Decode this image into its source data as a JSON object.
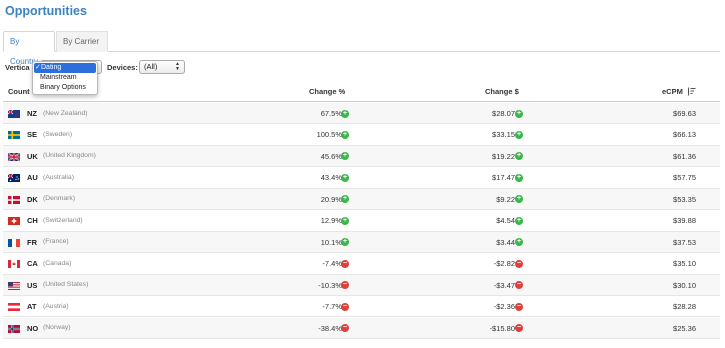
{
  "title": "Opportunities",
  "tabs": [
    {
      "label": "By Country",
      "active": true
    },
    {
      "label": "By Carrier",
      "active": false
    }
  ],
  "filters": {
    "verticals_label": "Vertica",
    "verticals_options": [
      "Dating",
      "Mainstream",
      "Binary Options"
    ],
    "verticals_selected": "Dating",
    "devices_label": "Devices:",
    "devices_value": "(All)"
  },
  "table": {
    "headers": {
      "country": "Count",
      "change_pct": "Change %",
      "change_usd": "Change $",
      "ecpm": "eCPM"
    },
    "rows": [
      {
        "code": "NZ",
        "name": "(New Zealand)",
        "change_pct": "67.5%",
        "change_usd": "$28.07",
        "ecpm": "$69.63",
        "trend": "up",
        "flag": "nz-flag-icon"
      },
      {
        "code": "SE",
        "name": "(Sweden)",
        "change_pct": "100.5%",
        "change_usd": "$33.15",
        "ecpm": "$66.13",
        "trend": "up",
        "flag": "se-flag-icon"
      },
      {
        "code": "UK",
        "name": "(United Kingdom)",
        "change_pct": "45.6%",
        "change_usd": "$19.22",
        "ecpm": "$61.36",
        "trend": "up",
        "flag": "uk-flag-icon"
      },
      {
        "code": "AU",
        "name": "(Australia)",
        "change_pct": "43.4%",
        "change_usd": "$17.47",
        "ecpm": "$57.75",
        "trend": "up",
        "flag": "au-flag-icon"
      },
      {
        "code": "DK",
        "name": "(Denmark)",
        "change_pct": "20.9%",
        "change_usd": "$9.22",
        "ecpm": "$53.35",
        "trend": "up",
        "flag": "dk-flag-icon"
      },
      {
        "code": "CH",
        "name": "(Switzerland)",
        "change_pct": "12.9%",
        "change_usd": "$4.54",
        "ecpm": "$39.88",
        "trend": "up",
        "flag": "ch-flag-icon"
      },
      {
        "code": "FR",
        "name": "(France)",
        "change_pct": "10.1%",
        "change_usd": "$3.44",
        "ecpm": "$37.53",
        "trend": "up",
        "flag": "fr-flag-icon"
      },
      {
        "code": "CA",
        "name": "(Canada)",
        "change_pct": "-7.4%",
        "change_usd": "-$2.82",
        "ecpm": "$35.10",
        "trend": "down",
        "flag": "ca-flag-icon"
      },
      {
        "code": "US",
        "name": "(United States)",
        "change_pct": "-10.3%",
        "change_usd": "-$3.47",
        "ecpm": "$30.10",
        "trend": "down",
        "flag": "us-flag-icon"
      },
      {
        "code": "AT",
        "name": "(Austria)",
        "change_pct": "-7.7%",
        "change_usd": "-$2.36",
        "ecpm": "$28.28",
        "trend": "down",
        "flag": "at-flag-icon"
      },
      {
        "code": "NO",
        "name": "(Norway)",
        "change_pct": "-38.4%",
        "change_usd": "-$15.80",
        "ecpm": "$25.36",
        "trend": "down",
        "flag": "no-flag-icon"
      }
    ]
  },
  "colors": {
    "accent": "#3b82c4",
    "up": "#3cb54a",
    "down": "#e0403c",
    "selected": "#2c6fdc"
  }
}
